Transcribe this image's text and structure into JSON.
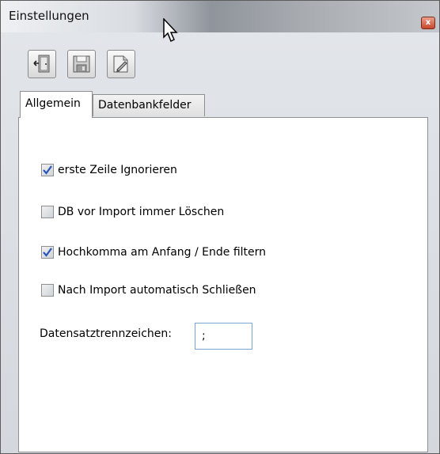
{
  "window": {
    "title": "Einstellungen",
    "close_glyph": "x"
  },
  "toolbar": {
    "buttons": [
      {
        "icon": "exit-door-icon"
      },
      {
        "icon": "save-disk-icon"
      },
      {
        "icon": "edit-document-icon"
      }
    ]
  },
  "tabs": [
    {
      "label": "Allgemein",
      "active": true
    },
    {
      "label": "Datenbankfelder",
      "active": false
    }
  ],
  "options": [
    {
      "label": "erste Zeile Ignorieren",
      "checked": true
    },
    {
      "label": "DB vor Import immer Löschen",
      "checked": false
    },
    {
      "label": "Hochkomma am Anfang / Ende filtern",
      "checked": true
    },
    {
      "label": "Nach Import automatisch Schließen",
      "checked": false
    }
  ],
  "separator": {
    "label": "Datensatztrennzeichen:",
    "value": ";"
  },
  "colors": {
    "check": "#2a55b8",
    "input_border": "#7aa6d4",
    "close": "#c7462a"
  }
}
